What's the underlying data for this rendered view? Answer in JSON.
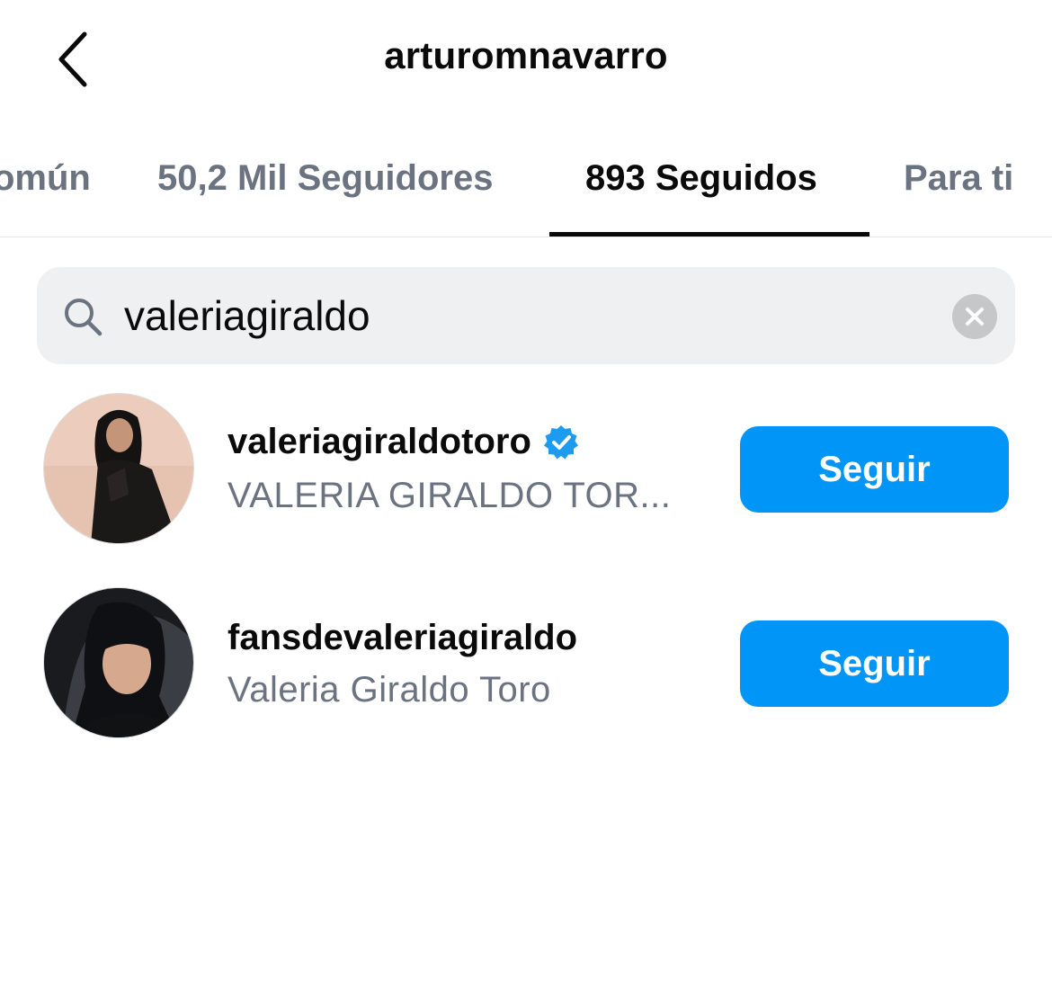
{
  "header": {
    "title": "arturomnavarro",
    "back_icon": "chevron-left-icon"
  },
  "tabs": [
    {
      "label": "omún",
      "active": false
    },
    {
      "label": "50,2 Mil Seguidores",
      "active": false
    },
    {
      "label": "893 Seguidos",
      "active": true
    },
    {
      "label": "Para ti",
      "active": false
    }
  ],
  "search": {
    "value": "valeriagiraldo",
    "search_icon": "search-icon",
    "clear_icon": "clear-icon"
  },
  "results": [
    {
      "username": "valeriagiraldotoro",
      "verified": true,
      "full_name": "VALERIA GIRALDO TOR...",
      "button_label": "Seguir"
    },
    {
      "username": "fansdevaleriagiraldo",
      "verified": false,
      "full_name": "Valeria Giraldo Toro",
      "button_label": "Seguir"
    }
  ],
  "colors": {
    "accent": "#0095f6",
    "muted_text": "#6b7280",
    "search_bg": "#eff0f2"
  }
}
